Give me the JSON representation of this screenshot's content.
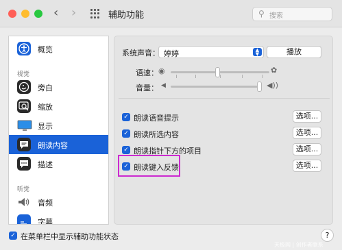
{
  "window": {
    "title": "辅助功能",
    "search_placeholder": "搜索",
    "colors": {
      "close": "#ff5f57",
      "minimize": "#febc2e",
      "zoom": "#28c840",
      "accent": "#1a62d8",
      "highlight": "#cc2ad0"
    }
  },
  "sidebar": {
    "overview": {
      "label": "概览",
      "icon": "accessibility-icon"
    },
    "section_vision": "视觉",
    "vision_items": [
      {
        "label": "旁白",
        "icon": "voiceover-icon"
      },
      {
        "label": "缩放",
        "icon": "zoom-icon"
      },
      {
        "label": "显示",
        "icon": "display-icon"
      },
      {
        "label": "朗读内容",
        "icon": "speech-bubble-icon",
        "selected": true
      },
      {
        "label": "描述",
        "icon": "descriptions-icon"
      }
    ],
    "section_hearing": "听觉",
    "hearing_items": [
      {
        "label": "音频",
        "icon": "speaker-icon"
      },
      {
        "label": "字幕",
        "icon": "captions-icon"
      }
    ]
  },
  "main": {
    "system_voice_label": "系统声音：",
    "system_voice_value": "婷婷",
    "play_button": "播放",
    "rate_label": "语速：",
    "volume_label": "音量：",
    "rate_value": 0.5,
    "volume_value": 1.0,
    "options": [
      {
        "label": "朗读语音提示",
        "checked": true,
        "button": "选项..."
      },
      {
        "label": "朗读所选内容",
        "checked": true,
        "button": "选项..."
      },
      {
        "label": "朗读指针下方的项目",
        "checked": true,
        "button": "选项..."
      },
      {
        "label": "朗读键入反馈",
        "checked": true,
        "button": "选项...",
        "highlighted": true
      }
    ]
  },
  "footer": {
    "menu_bar_checkbox_label": "在菜单栏中显示辅助功能状态",
    "menu_bar_checked": true,
    "help": "?",
    "watermark": "天极网 | 创作者联系"
  }
}
